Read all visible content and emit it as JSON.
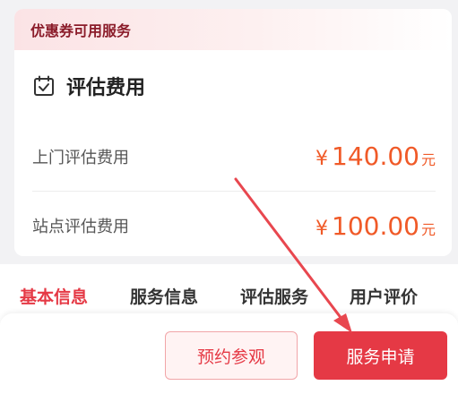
{
  "coupon": {
    "header": "优惠券可用服务"
  },
  "evaluation": {
    "title": "评估费用",
    "icon": "calendar-check-icon",
    "fees": [
      {
        "label": "上门评估费用",
        "currency": "¥",
        "value": "140.00",
        "unit": "元"
      },
      {
        "label": "站点评估费用",
        "currency": "¥",
        "value": "100.00",
        "unit": "元"
      }
    ]
  },
  "tabs": [
    {
      "label": "基本信息",
      "active": true
    },
    {
      "label": "服务信息",
      "active": false
    },
    {
      "label": "评估服务",
      "active": false
    },
    {
      "label": "用户评价",
      "active": false
    }
  ],
  "actions": {
    "reserve_label": "预约参观",
    "apply_label": "服务申请"
  },
  "colors": {
    "accent": "#e53945",
    "price": "#f05a28",
    "annotation_arrow": "#e8474f"
  }
}
